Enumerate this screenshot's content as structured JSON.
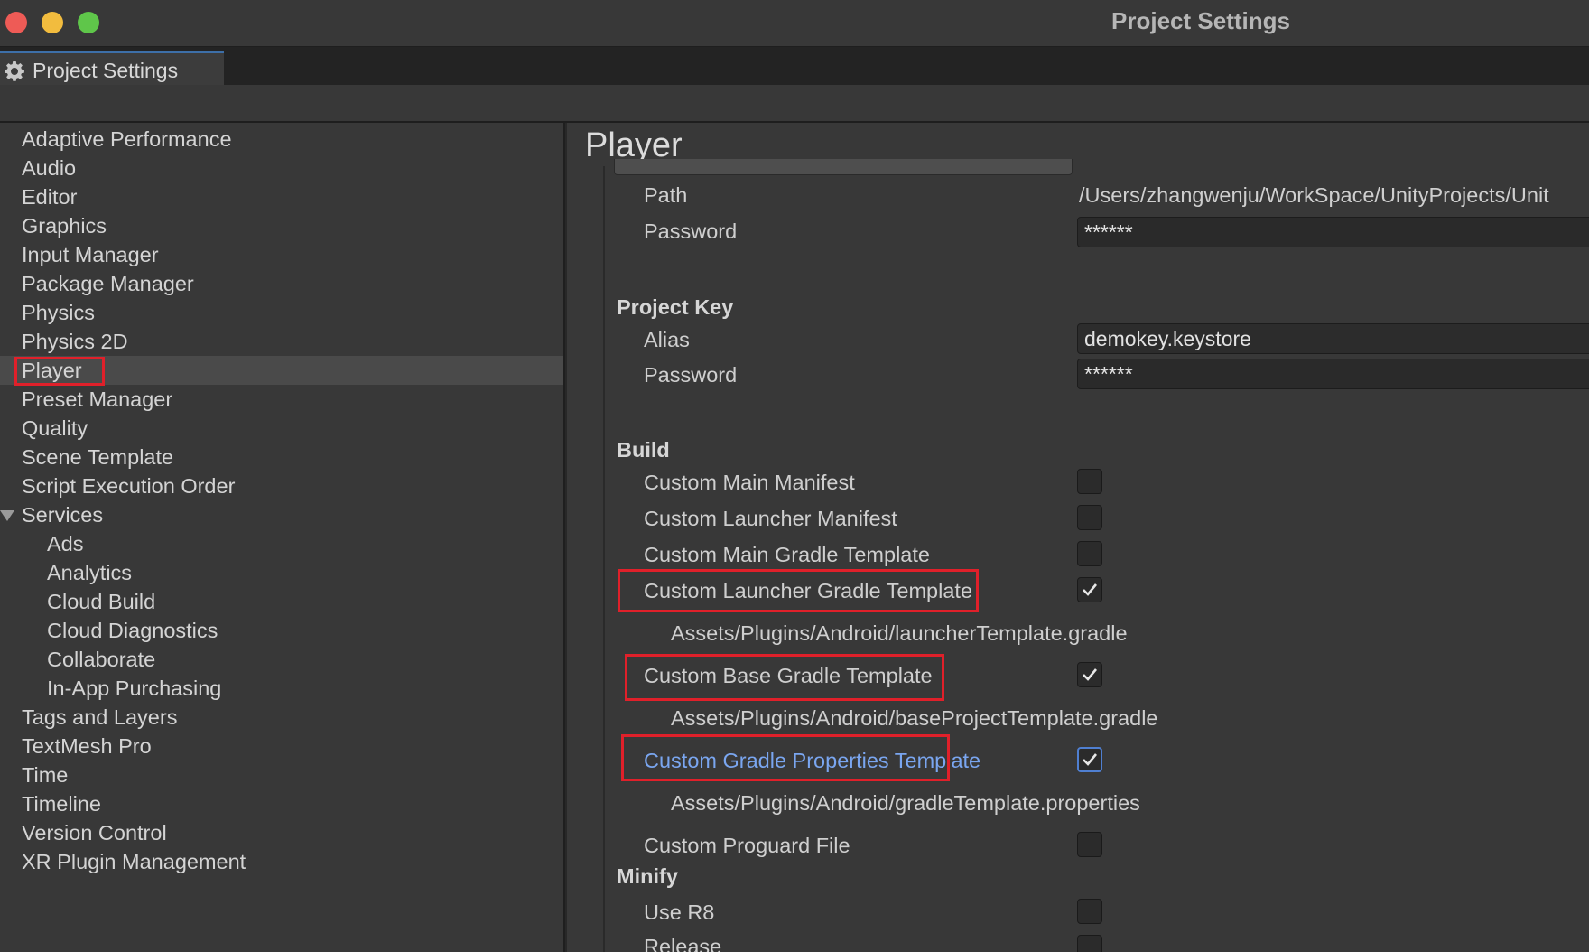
{
  "window": {
    "title": "Project Settings"
  },
  "tab": {
    "label": "Project Settings",
    "icon": "gear-icon"
  },
  "sidebar": {
    "items": [
      {
        "label": "Adaptive Performance",
        "indent": 0
      },
      {
        "label": "Audio",
        "indent": 0
      },
      {
        "label": "Editor",
        "indent": 0
      },
      {
        "label": "Graphics",
        "indent": 0
      },
      {
        "label": "Input Manager",
        "indent": 0
      },
      {
        "label": "Package Manager",
        "indent": 0
      },
      {
        "label": "Physics",
        "indent": 0
      },
      {
        "label": "Physics 2D",
        "indent": 0
      },
      {
        "label": "Player",
        "indent": 0,
        "selected": true
      },
      {
        "label": "Preset Manager",
        "indent": 0
      },
      {
        "label": "Quality",
        "indent": 0
      },
      {
        "label": "Scene Template",
        "indent": 0
      },
      {
        "label": "Script Execution Order",
        "indent": 0
      },
      {
        "label": "Services",
        "indent": 0,
        "expanded": true
      },
      {
        "label": "Ads",
        "indent": 1
      },
      {
        "label": "Analytics",
        "indent": 1
      },
      {
        "label": "Cloud Build",
        "indent": 1
      },
      {
        "label": "Cloud Diagnostics",
        "indent": 1
      },
      {
        "label": "Collaborate",
        "indent": 1
      },
      {
        "label": "In-App Purchasing",
        "indent": 1
      },
      {
        "label": "Tags and Layers",
        "indent": 0
      },
      {
        "label": "TextMesh Pro",
        "indent": 0
      },
      {
        "label": "Time",
        "indent": 0
      },
      {
        "label": "Timeline",
        "indent": 0
      },
      {
        "label": "Version Control",
        "indent": 0
      },
      {
        "label": "XR Plugin Management",
        "indent": 0
      }
    ]
  },
  "main": {
    "title": "Player",
    "keystore": {
      "path_label": "Path",
      "path_value": "/Users/zhangwenju/WorkSpace/UnityProjects/Unit",
      "password_label": "Password",
      "password_value": "******"
    },
    "project_key": {
      "header": "Project Key",
      "alias_label": "Alias",
      "alias_value": "demokey.keystore",
      "password_label": "Password",
      "password_value": "******"
    },
    "build": {
      "header": "Build",
      "custom_main_manifest": {
        "label": "Custom Main Manifest",
        "checked": false
      },
      "custom_launcher_manifest": {
        "label": "Custom Launcher Manifest",
        "checked": false
      },
      "custom_main_gradle_template": {
        "label": "Custom Main Gradle Template",
        "checked": false
      },
      "custom_launcher_gradle_template": {
        "label": "Custom Launcher Gradle Template",
        "checked": true,
        "path": "Assets/Plugins/Android/launcherTemplate.gradle"
      },
      "custom_base_gradle_template": {
        "label": "Custom Base Gradle Template",
        "checked": true,
        "path": "Assets/Plugins/Android/baseProjectTemplate.gradle"
      },
      "custom_gradle_properties_template": {
        "label": "Custom Gradle Properties Template",
        "checked": true,
        "path": "Assets/Plugins/Android/gradleTemplate.properties"
      },
      "custom_proguard_file": {
        "label": "Custom Proguard File",
        "checked": false
      }
    },
    "minify": {
      "header": "Minify",
      "use_r8": {
        "label": "Use R8",
        "checked": false
      },
      "release": {
        "label": "Release",
        "checked": false
      }
    }
  },
  "colors": {
    "highlight_box": "#e0202a",
    "focused_label": "#7aa6f0",
    "tab_accent": "#3d6fa8"
  }
}
